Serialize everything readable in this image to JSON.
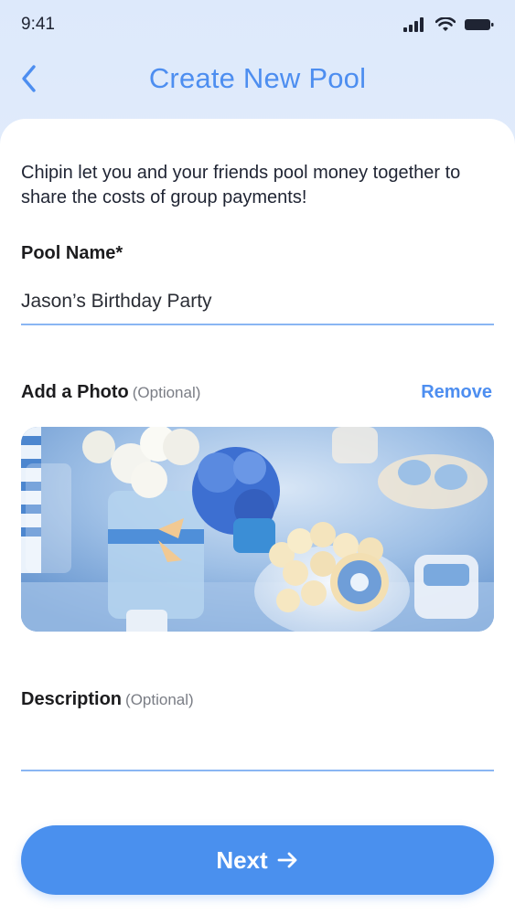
{
  "status_bar": {
    "time": "9:41",
    "icons": [
      "signal-icon",
      "wifi-icon",
      "battery-icon"
    ]
  },
  "header": {
    "back_icon": "chevron-left-icon",
    "title": "Create New Pool"
  },
  "form": {
    "intro": "Chipin let you and your friends pool money together to share the costs of group payments!",
    "pool_name": {
      "label": "Pool Name*",
      "value": "Jason’s Birthday Party"
    },
    "photo": {
      "label": "Add a Photo",
      "optional": "(Optional)",
      "remove_label": "Remove"
    },
    "description": {
      "label": "Description",
      "optional": "(Optional)",
      "value": ""
    },
    "next_label": "Next",
    "next_icon": "arrow-right-icon"
  },
  "colors": {
    "accent": "#4a90ee",
    "title": "#4d8ef0",
    "underline": "#8ab6f3",
    "background": "#e4edfb"
  }
}
